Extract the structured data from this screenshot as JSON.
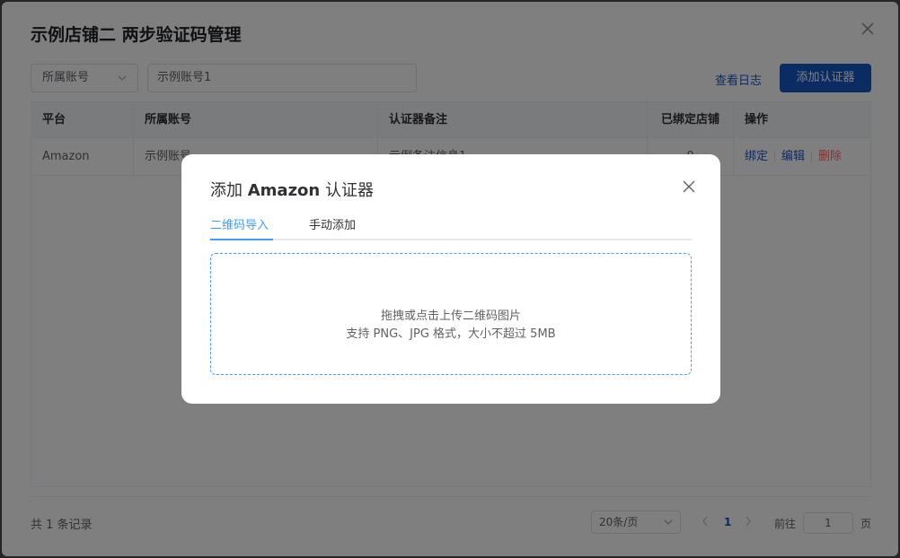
{
  "dialog": {
    "title": "示例店铺二 两步验证码管理",
    "filter": {
      "account_select": "所属账号",
      "account_input": "示例账号1"
    },
    "log_link": "查看日志",
    "add_button": "添加认证器",
    "table": {
      "headers": [
        "平台",
        "所属账号",
        "认证器备注",
        "已绑定店铺",
        "操作"
      ],
      "rows": [
        {
          "platform": "Amazon",
          "account": "示例账号",
          "note": "示例备注信息1",
          "bound": "0",
          "actions": [
            "绑定",
            "编辑",
            "删除"
          ]
        }
      ]
    },
    "footer": {
      "total": "共 1 条记录",
      "page_size": "20条/页",
      "current_page": "1",
      "goto_label": "前往",
      "goto_value": "1",
      "goto_suffix": "页"
    }
  },
  "modal": {
    "title_prefix": "添加 ",
    "title_brand": "Amazon",
    "title_suffix": " 认证器",
    "tabs": [
      {
        "label": "二维码导入",
        "active": true
      },
      {
        "label": "手动添加",
        "active": false
      }
    ],
    "upload": {
      "line1": "拖拽或点击上传二维码图片",
      "line2": "支持 PNG、JPG 格式，大小不超过 5MB"
    }
  },
  "colors": {
    "primary": "#1659c7",
    "accent": "#409eff",
    "danger": "#f56c6c"
  }
}
